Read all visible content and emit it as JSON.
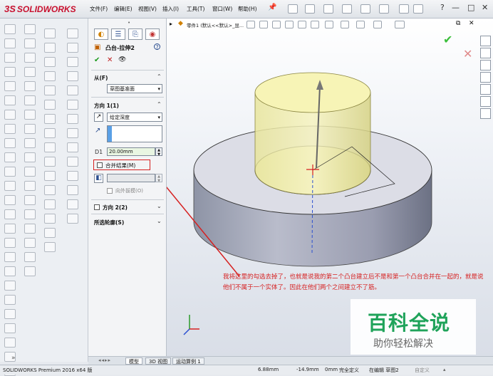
{
  "app": {
    "logo_prefix": "3S",
    "logo_text": "SOLIDWORKS"
  },
  "menu": [
    "文件(F)",
    "编辑(E)",
    "视图(V)",
    "插入(I)",
    "工具(T)",
    "窗口(W)",
    "帮助(H)"
  ],
  "window": {
    "minimize": "—",
    "restore": "□",
    "close": "✕"
  },
  "property_manager": {
    "title": "凸台-拉伸2",
    "help": "?",
    "ok": "✔",
    "cancel": "✕",
    "preview": "👁",
    "from_label": "从(F)",
    "from_value": "草图基准面",
    "direction1_label": "方向 1(1)",
    "end_condition": "给定深度",
    "depth_value": "20.00mm",
    "merge_label": "合并结果(M)",
    "draft_outward_label": "向外拔模(O)",
    "direction2_label": "方向 2(2)",
    "contours_label": "所选轮廓(S)"
  },
  "viewport": {
    "tree_item": "零件1 (默认<<默认>_显...",
    "accent": "#3cbf3c"
  },
  "tabs": [
    "模型",
    "3D 视图",
    "运动算例 1"
  ],
  "status": {
    "product": "SOLIDWORKS Premium 2016 x64 版",
    "x": "6.88mm",
    "y": "-14.9mm",
    "z": "0mm",
    "state": "完全定义",
    "editing": "在编辑 草图2",
    "custom": "自定义"
  },
  "annotation": "我将这里的勾选去掉了，也就是说我的第二个凸台建立后不是和第一个凸台合并在一起的，就是说他们不属于一个实体了。因此在他们两个之间建立不了筋。",
  "watermark": {
    "main": "百科全说",
    "sub": "助你轻松解决"
  }
}
